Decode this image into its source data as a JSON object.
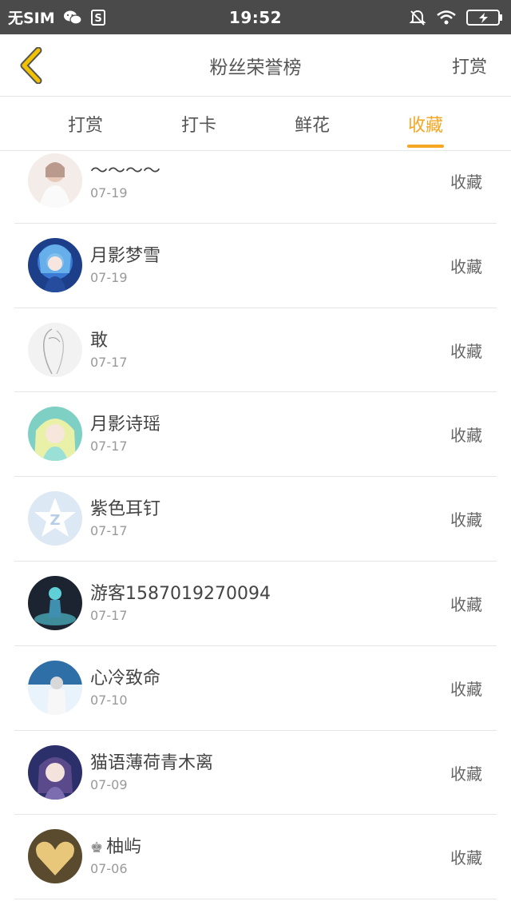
{
  "status_bar": {
    "carrier": "无SIM",
    "time": "19:52"
  },
  "navbar": {
    "title": "粉丝荣誉榜",
    "right_label": "打赏"
  },
  "tabs": [
    {
      "label": "打赏",
      "active": false
    },
    {
      "label": "打卡",
      "active": false
    },
    {
      "label": "鲜花",
      "active": false
    },
    {
      "label": "收藏",
      "active": true
    }
  ],
  "accent_color": "#f5a623",
  "fans": [
    {
      "name": "～～～～",
      "date": "07-19",
      "action": "收藏",
      "avatar": "girl-white-avatar"
    },
    {
      "name": "月影梦雪",
      "date": "07-19",
      "action": "收藏",
      "avatar": "anime-blue-avatar"
    },
    {
      "name": "敢",
      "date": "07-17",
      "action": "收藏",
      "avatar": "sketch-avatar"
    },
    {
      "name": "月影诗瑶",
      "date": "07-17",
      "action": "收藏",
      "avatar": "anime-green-avatar"
    },
    {
      "name": "紫色耳钉",
      "date": "07-17",
      "action": "收藏",
      "avatar": "default-star-avatar"
    },
    {
      "name": "游客1587019270094",
      "date": "07-17",
      "action": "收藏",
      "avatar": "anime-dark-avatar"
    },
    {
      "name": "心冷致命",
      "date": "07-10",
      "action": "收藏",
      "avatar": "winter-avatar"
    },
    {
      "name": "猫语薄荷青木离",
      "date": "07-09",
      "action": "收藏",
      "avatar": "purple-girl-avatar"
    },
    {
      "name": "柚屿",
      "date": "07-06",
      "action": "收藏",
      "avatar": "heart-avatar",
      "crown": "♚"
    }
  ]
}
